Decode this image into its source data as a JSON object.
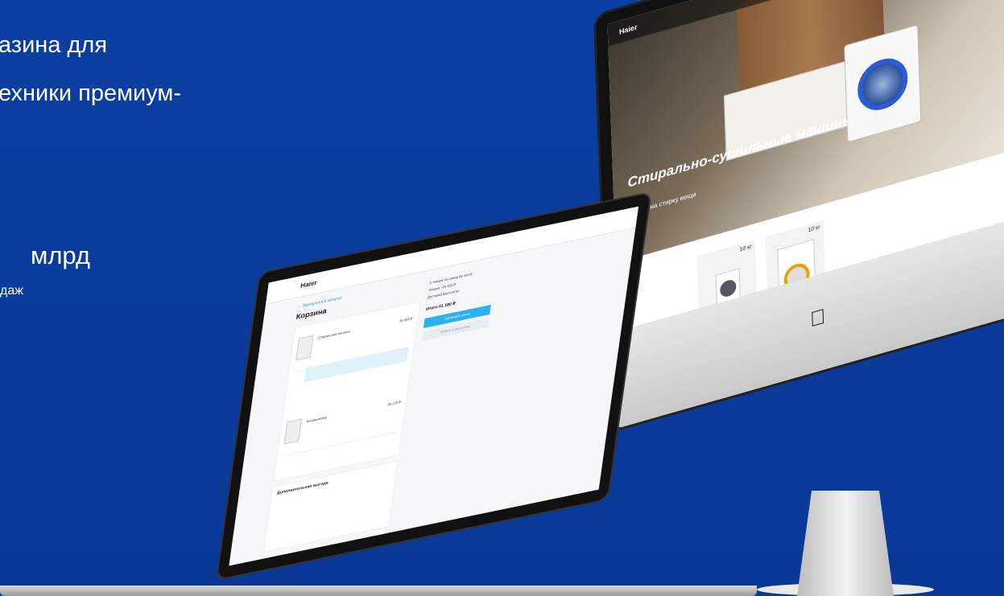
{
  "hero": {
    "line1": "азина для",
    "line2": "ехники премиум-",
    "stat_value": "млрд",
    "stat_caption": "даж"
  },
  "imac": {
    "logo": "Haier",
    "banner_title": "Стирально-сушильные машины",
    "banner_subtitle": "взгляд на стирку вещи",
    "products": [
      {
        "size": "10 кг"
      },
      {
        "size": "10 кг"
      }
    ],
    "apple_logo": "apple-logo"
  },
  "laptop": {
    "logo": "Haier",
    "breadcrumb": "← Вернуться в каталог",
    "title": "Корзина",
    "cart_items": [
      {
        "name": "Стиральная машина",
        "price": "35 900 ₽"
      },
      {
        "name": "Кондиционер",
        "price": "30 270 ₽"
      }
    ],
    "summary": {
      "rows": [
        "2 товара на сумму   66 160 ₽",
        "Скидка   −20 320 ₽",
        "Доставка   Бесплатно"
      ],
      "total_label": "Итого",
      "total_value": "61 180 ₽",
      "checkout": "Оформить заказ",
      "continue": "Купить в рассрочку"
    },
    "extra_title": "Дополнительная выгода"
  },
  "colors": {
    "background": "#0a3a9a",
    "accent": "#2bb0f0"
  }
}
